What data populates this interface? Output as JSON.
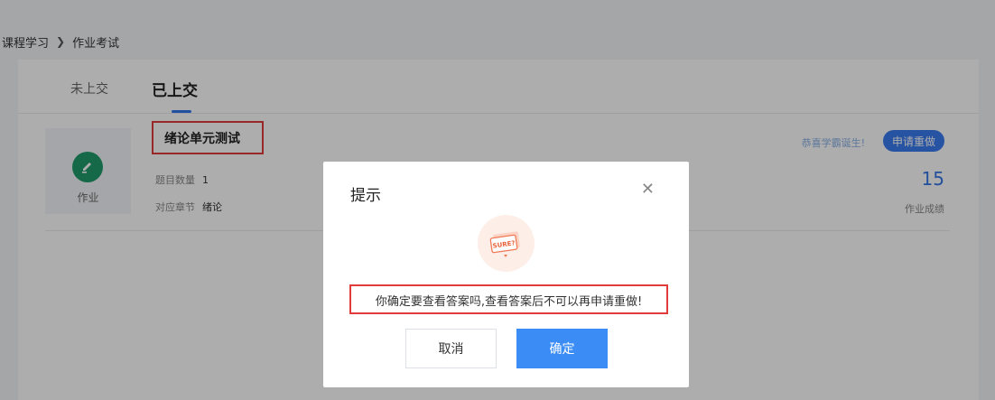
{
  "breadcrumb": {
    "parent": "课程学习",
    "current": "作业考试"
  },
  "tabs": [
    {
      "label": "未上交"
    },
    {
      "label": "已上交"
    }
  ],
  "homework": {
    "icon_name": "pencil-icon",
    "type_label": "作业",
    "title": "绪论单元测试",
    "question_count_label": "题目数量",
    "question_count": "1",
    "chapter_label": "对应章节",
    "chapter": "绪论",
    "congrats": "恭喜学霸诞生!",
    "redo_button": "申请重做",
    "score": "15",
    "score_label": "作业成绩"
  },
  "dialog": {
    "title": "提示",
    "illustration": "SURE?",
    "message": "你确定要查看答案吗,查看答案后不可以再申请重做!",
    "cancel_label": "取消",
    "ok_label": "确定"
  },
  "colors": {
    "accent": "#3a7bf0",
    "highlight_border": "#e23b3b",
    "icon_green": "#1f9a6b",
    "score_blue": "#3477e6"
  }
}
